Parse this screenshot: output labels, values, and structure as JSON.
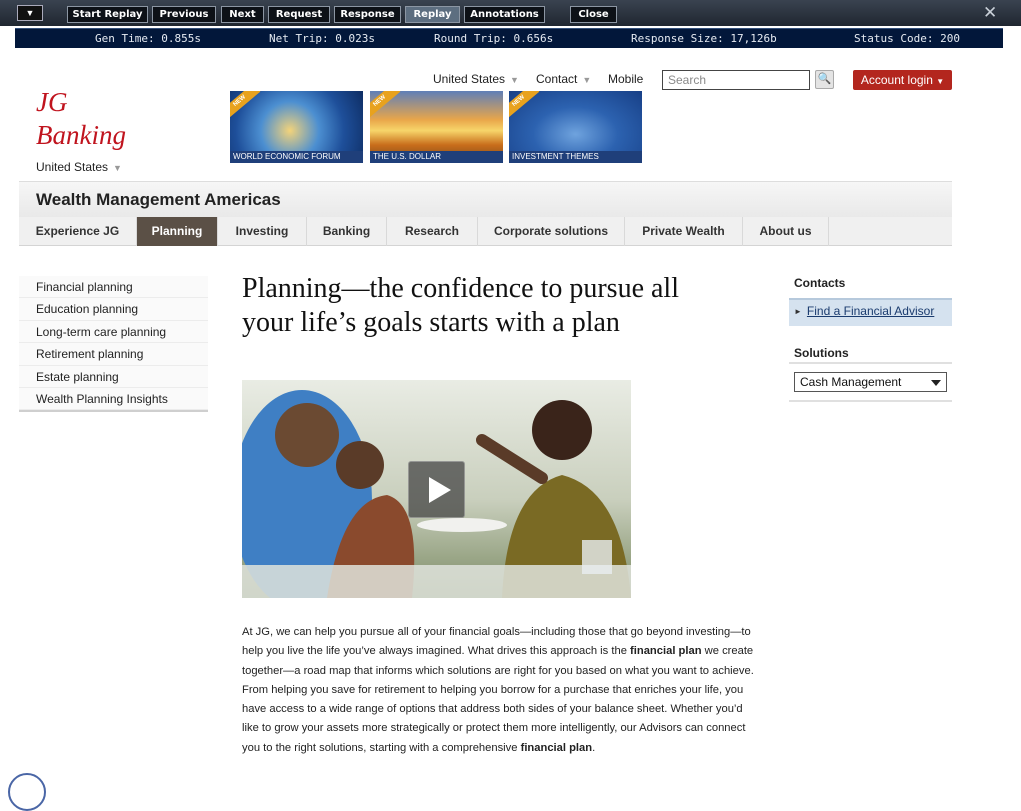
{
  "replay_toolbar": {
    "buttons": [
      "Start Replay",
      "Previous",
      "Next",
      "Request",
      "Response",
      "Replay",
      "Annotations",
      "Close"
    ],
    "active": "Replay"
  },
  "status": {
    "gen_time": "Gen Time: 0.855s",
    "net_trip": "Net Trip: 0.023s",
    "round_trip": "Round Trip: 0.656s",
    "response_size": "Response Size: 17,126b",
    "status_code": "Status Code: 200"
  },
  "header": {
    "logo_line1": "JG",
    "logo_line2": "Banking",
    "country": "United States",
    "util_country": "United States",
    "contact": "Contact",
    "mobile": "Mobile",
    "search_placeholder": "Search",
    "account_login": "Account login"
  },
  "banners": [
    {
      "ribbon": "NEW",
      "caption": "WORLD ECONOMIC FORUM"
    },
    {
      "ribbon": "NEW",
      "caption": "THE U.S. DOLLAR"
    },
    {
      "ribbon": "NEW",
      "caption": "INVESTMENT THEMES"
    }
  ],
  "section_title": "Wealth Management Americas",
  "nav": {
    "items": [
      "Experience JG",
      "Planning",
      "Investing",
      "Banking",
      "Research",
      "Corporate solutions",
      "Private Wealth",
      "About us"
    ],
    "active": "Planning"
  },
  "sidebar": {
    "items": [
      "Financial planning",
      "Education planning",
      "Long-term care planning",
      "Retirement planning",
      "Estate planning",
      "Wealth Planning Insights"
    ]
  },
  "main": {
    "headline_line1": "Planning—the confidence to pursue all",
    "headline_line2": "your life’s goals starts with a plan",
    "body_p1": "At JG, we can help you pursue all of your financial goals—including those that go beyond investing—to help you live the life you’ve always imagined. What drives this approach is the ",
    "body_bold1": "financial plan",
    "body_p2": " we create together—a road map that informs which solutions are right for you based on what you want to achieve. From helping you save for retirement to helping you borrow for a purchase that enriches your life, you have access to a wide range of options that address both sides of your balance sheet. Whether you’d like to grow your assets more strategically or protect them more intelligently, our Advisors can connect you to the right solutions, starting with a comprehensive ",
    "body_bold2": "financial plan",
    "body_end": "."
  },
  "rail": {
    "contacts_title": "Contacts",
    "advisor_link": "Find a Financial Advisor",
    "solutions_title": "Solutions",
    "solutions_selected": "Cash Management"
  },
  "colors": {
    "brand_red": "#c0141e",
    "login_red": "#b3261e",
    "nav_active": "#5b5046",
    "status_bar_bg": "#02173a"
  }
}
